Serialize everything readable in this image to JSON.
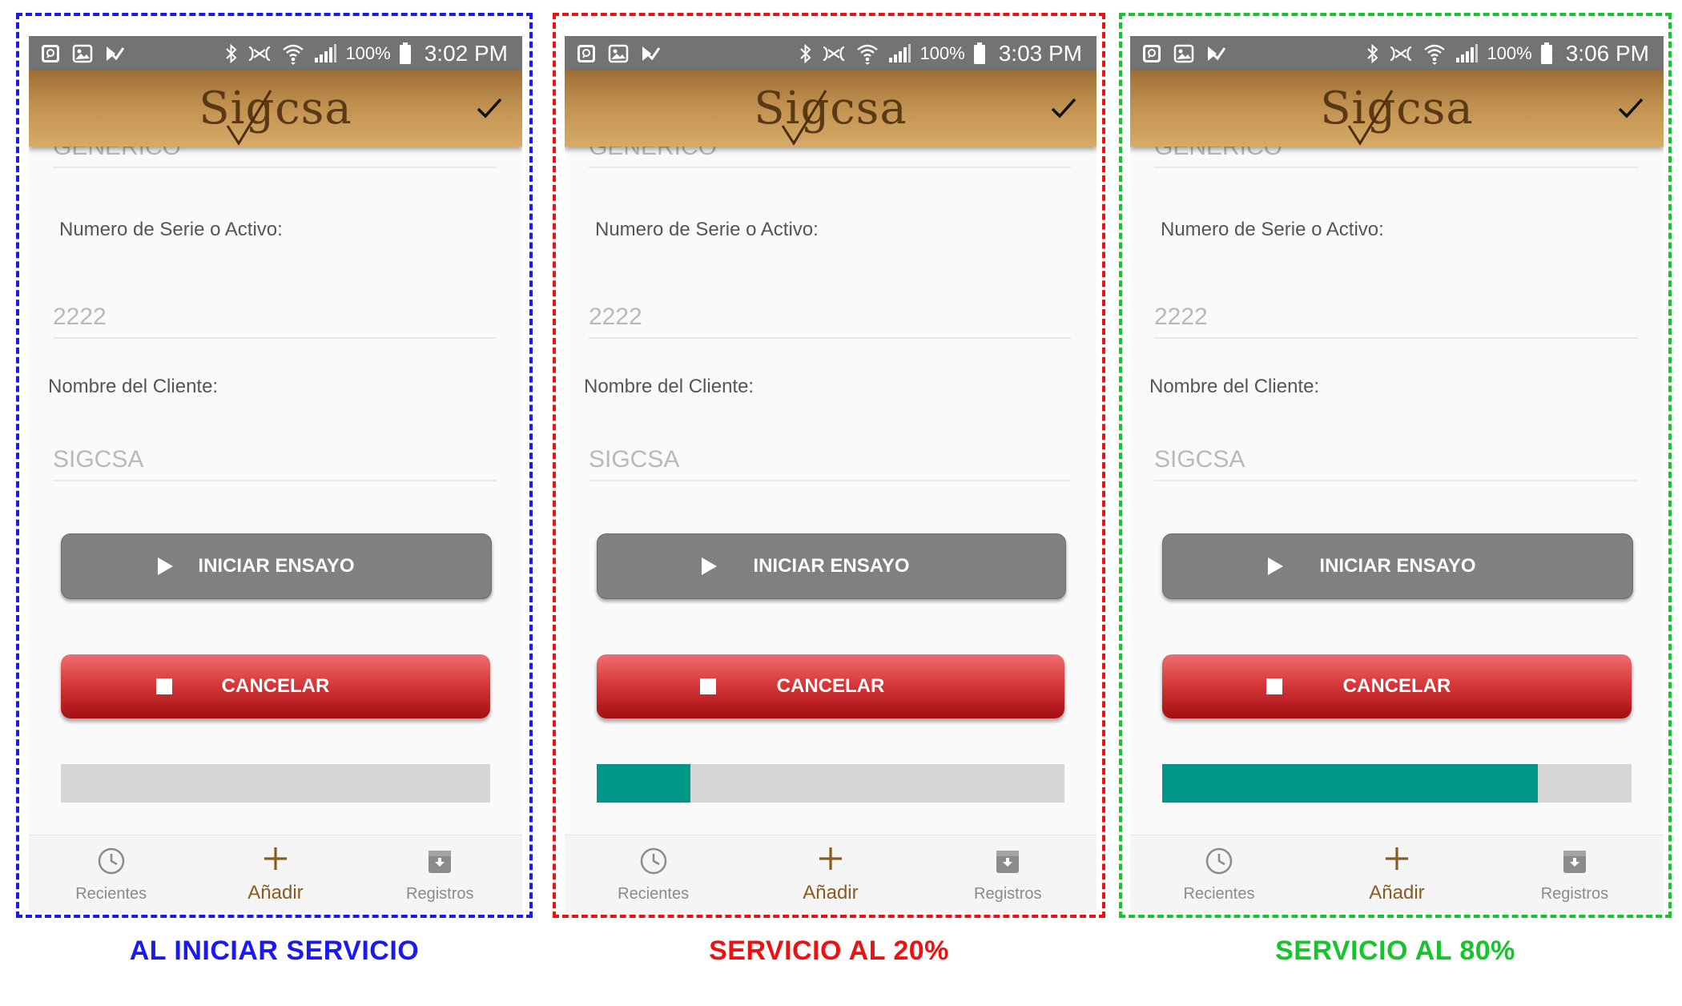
{
  "screens": [
    {
      "status": {
        "battery": "100%",
        "time": "3:02 PM"
      },
      "app": {
        "logo_text": "Sigcsa"
      },
      "form": {
        "prev_value": "GENERICO",
        "serial_label": "Numero de Serie o Activo:",
        "serial_value": "2222",
        "client_label": "Nombre del Cliente:",
        "client_value": "SIGCSA"
      },
      "buttons": {
        "start": "INICIAR ENSAYO",
        "cancel": "CANCELAR"
      },
      "progress": 0,
      "nav": {
        "recent": "Recientes",
        "add": "Añadir",
        "records": "Registros"
      },
      "caption": "AL INICIAR SERVICIO",
      "frame_color": "#1a1aee",
      "caption_color": "#1a1aee"
    },
    {
      "status": {
        "battery": "100%",
        "time": "3:03 PM"
      },
      "app": {
        "logo_text": "Sigcsa"
      },
      "form": {
        "prev_value": "GENERICO",
        "serial_label": "Numero de Serie o Activo:",
        "serial_value": "2222",
        "client_label": "Nombre del Cliente:",
        "client_value": "SIGCSA"
      },
      "buttons": {
        "start": "INICIAR ENSAYO",
        "cancel": "CANCELAR"
      },
      "progress": 0.2,
      "nav": {
        "recent": "Recientes",
        "add": "Añadir",
        "records": "Registros"
      },
      "caption": "SERVICIO AL 20%",
      "frame_color": "#ee1111",
      "caption_color": "#ee1111"
    },
    {
      "status": {
        "battery": "100%",
        "time": "3:06 PM"
      },
      "app": {
        "logo_text": "Sigcsa"
      },
      "form": {
        "prev_value": "GENERICO",
        "serial_label": "Numero de Serie o Activo:",
        "serial_value": "2222",
        "client_label": "Nombre del Cliente:",
        "client_value": "SIGCSA"
      },
      "buttons": {
        "start": "INICIAR ENSAYO",
        "cancel": "CANCELAR"
      },
      "progress": 0.8,
      "nav": {
        "recent": "Recientes",
        "add": "Añadir",
        "records": "Registros"
      },
      "caption": "SERVICIO AL 80%",
      "frame_color": "#17c42b",
      "caption_color": "#17c42b"
    }
  ],
  "icons": [
    "photo-viewer-icon",
    "gallery-icon",
    "task-icon",
    "bluetooth-icon",
    "nfc-mute-icon",
    "wifi-icon",
    "signal-icon",
    "battery-icon",
    "check-icon",
    "play-icon",
    "stop-icon",
    "clock-icon",
    "plus-icon",
    "archive-icon"
  ]
}
